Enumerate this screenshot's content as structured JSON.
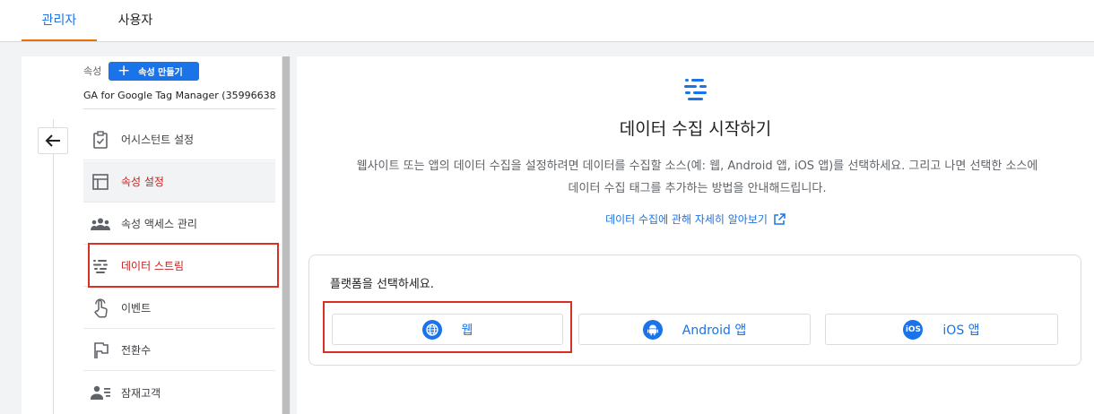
{
  "tabs": [
    {
      "label": "관리자",
      "active": true
    },
    {
      "label": "사용자",
      "active": false
    }
  ],
  "property": {
    "label": "속성",
    "create_button": "속성 만들기",
    "name": "GA for Google Tag Manager (35996638..."
  },
  "nav": {
    "items": [
      {
        "label": "어시스턴트 설정",
        "icon": "clipboard-check-icon"
      },
      {
        "label": "속성 설정",
        "icon": "layout-icon",
        "selected": true
      },
      {
        "label": "속성 액세스 관리",
        "icon": "people-icon"
      },
      {
        "label": "데이터 스트림",
        "icon": "data-streams-icon",
        "highlighted": true
      },
      {
        "label": "이벤트",
        "icon": "touch-icon"
      },
      {
        "label": "전환수",
        "icon": "flag-icon"
      },
      {
        "label": "잠재고객",
        "icon": "audience-icon"
      }
    ]
  },
  "main": {
    "icon": "data-streams-icon",
    "title": "데이터 수집 시작하기",
    "description": "웹사이트 또는 앱의 데이터 수집을 설정하려면 데이터를 수집할 소스(예: 웹, Android 앱, iOS 앱)를 선택하세요. 그리고 나면 선택한 소스에 데이터 수집 태그를 추가하는 방법을 안내해드립니다.",
    "learn_more": "데이터 수집에 관해 자세히 알아보기",
    "platform_prompt": "플랫폼을 선택하세요.",
    "platforms": [
      {
        "label": "웹",
        "icon": "globe-icon"
      },
      {
        "label": "Android 앱",
        "icon": "android-icon"
      },
      {
        "label": "iOS 앱",
        "icon": "ios-icon",
        "icon_text": "iOS"
      }
    ]
  },
  "colors": {
    "accent": "#1a73e8",
    "highlight_red": "#d93025",
    "tab_underline": "#e8710a",
    "selected_text": "#c5221f"
  }
}
